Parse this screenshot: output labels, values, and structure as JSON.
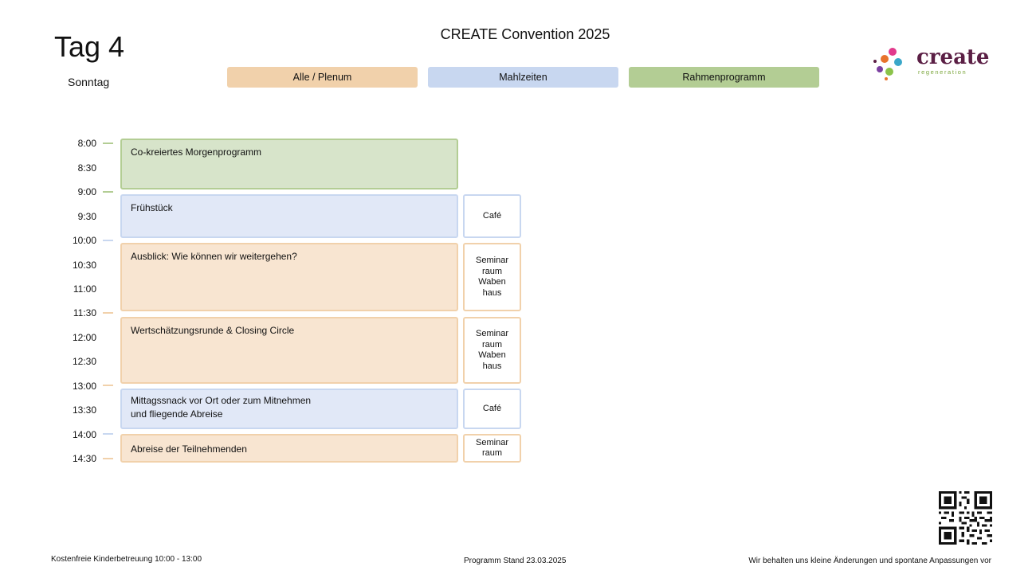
{
  "header": {
    "day_title": "Tag 4",
    "day_name": "Sonntag",
    "convention_title": "CREATE Convention 2025"
  },
  "legend": {
    "plenum": "Alle / Plenum",
    "meals": "Mahlzeiten",
    "frame": "Rahmenprogramm"
  },
  "colors": {
    "plenum": "#f1d1ab",
    "meals": "#c8d7f0",
    "frame": "#b3cd94"
  },
  "times": [
    "8:00",
    "8:30",
    "9:00",
    "9:30",
    "10:00",
    "10:30",
    "11:00",
    "11:30",
    "12:00",
    "12:30",
    "13:00",
    "13:30",
    "14:00",
    "14:30"
  ],
  "events": [
    {
      "title": "Co-kreiertes Morgenprogramm",
      "room": ""
    },
    {
      "title": "Frühstück",
      "room": "Café"
    },
    {
      "title": "Ausblick: Wie können wir weitergehen?",
      "room_lines": [
        "Seminar",
        "raum",
        "Waben",
        "haus"
      ]
    },
    {
      "title": "Wertschätzungsrunde & Closing Circle",
      "room_lines": [
        "Seminar",
        "raum",
        "Waben",
        "haus"
      ]
    },
    {
      "title_lines": [
        "Mittagssnack vor Ort oder zum Mitnehmen",
        "und fliegende Abreise"
      ],
      "room": "Café"
    },
    {
      "title": "Abreise der Teilnehmenden",
      "room_lines": [
        "Seminar",
        "raum"
      ]
    }
  ],
  "logo": {
    "word": "create",
    "sub": "regeneration"
  },
  "footer": {
    "left": "Kostenfreie Kinderbetreuung 10:00 - 13:00",
    "mid": "Programm Stand 23.03.2025",
    "right": "Wir behalten uns kleine Änderungen und spontane Anpassungen vor"
  }
}
